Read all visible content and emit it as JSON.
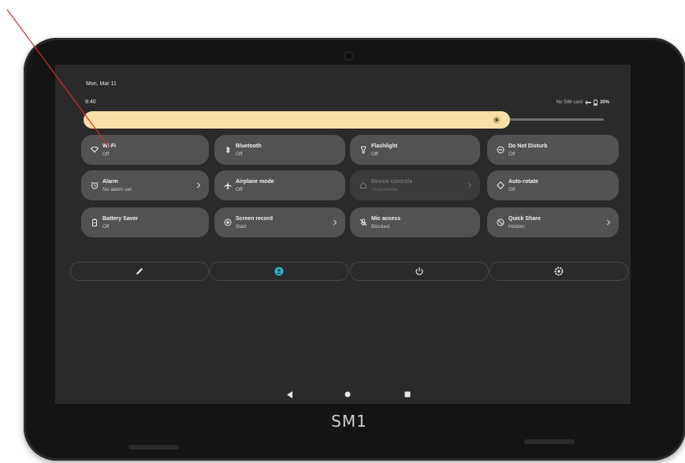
{
  "status_bar": {
    "date": "Mon, Mar 11",
    "time": "9:40",
    "sim": "No SIM card",
    "battery": "30%"
  },
  "brightness": {
    "level_fraction": 0.82
  },
  "tiles": [
    {
      "id": "wifi",
      "label": "Wi-Fi",
      "status": "Off",
      "icon": "wifi-icon",
      "active": true,
      "chevron": false
    },
    {
      "id": "bluetooth",
      "label": "Bluetooth",
      "status": "Off",
      "icon": "bluetooth-icon",
      "active": true,
      "chevron": false
    },
    {
      "id": "flashlight",
      "label": "Flashlight",
      "status": "Off",
      "icon": "flashlight-icon",
      "active": true,
      "chevron": false
    },
    {
      "id": "dnd",
      "label": "Do Not Disturb",
      "status": "Off",
      "icon": "do-not-disturb-icon",
      "active": true,
      "chevron": false
    },
    {
      "id": "alarm",
      "label": "Alarm",
      "status": "No alarm set",
      "icon": "alarm-icon",
      "active": true,
      "chevron": true
    },
    {
      "id": "airplane",
      "label": "Airplane mode",
      "status": "Off",
      "icon": "airplane-icon",
      "active": true,
      "chevron": false
    },
    {
      "id": "device-controls",
      "label": "Device controls",
      "status": "Unavailable",
      "icon": "home-icon",
      "active": false,
      "chevron": true
    },
    {
      "id": "auto-rotate",
      "label": "Auto-rotate",
      "status": "Off",
      "icon": "rotate-icon",
      "active": true,
      "chevron": false
    },
    {
      "id": "battery-saver",
      "label": "Battery Saver",
      "status": "Off",
      "icon": "battery-icon",
      "active": true,
      "chevron": false
    },
    {
      "id": "screen-record",
      "label": "Screen record",
      "status": "Start",
      "icon": "record-icon",
      "active": true,
      "chevron": true
    },
    {
      "id": "mic-access",
      "label": "Mic access",
      "status": "Blocked",
      "icon": "mic-off-icon",
      "active": true,
      "chevron": false
    },
    {
      "id": "quick-share",
      "label": "Quick Share",
      "status": "Hidden",
      "icon": "quick-share-icon",
      "active": true,
      "chevron": true
    }
  ],
  "actions": [
    {
      "id": "edit",
      "icon": "pencil-icon"
    },
    {
      "id": "user",
      "icon": "user-icon"
    },
    {
      "id": "power",
      "icon": "power-icon"
    },
    {
      "id": "settings",
      "icon": "gear-icon"
    }
  ],
  "nav_bar": [
    "back-icon",
    "home-icon",
    "recents-icon"
  ],
  "device": {
    "brand": "SM1"
  },
  "colors": {
    "accent": "#f7dfa7",
    "tile": "#525252",
    "tile_disabled": "#3b3b3b",
    "screen_bg": "#2a2a2a",
    "user_icon": "#2bb8d6",
    "pointer": "#d12a2a"
  }
}
